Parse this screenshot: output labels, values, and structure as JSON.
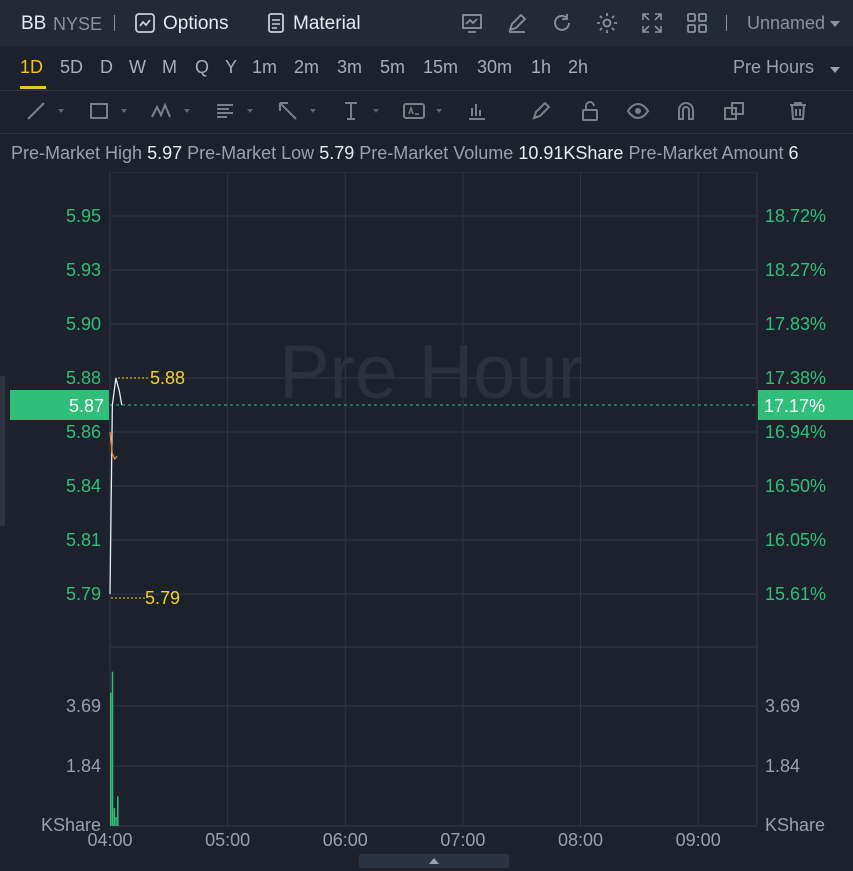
{
  "header": {
    "ticker": "BB",
    "exchange": "NYSE",
    "options_label": "Options",
    "material_label": "Material",
    "layout_name": "Unnamed",
    "icons": [
      "options-chart-icon",
      "document-icon",
      "chart-settings-icon",
      "edit-icon",
      "refresh-icon",
      "gear-icon",
      "fullscreen-icon",
      "grid-layout-icon",
      "chevron-down-icon"
    ]
  },
  "intervals": {
    "items": [
      "1D",
      "5D",
      "D",
      "W",
      "M",
      "Q",
      "Y",
      "1m",
      "2m",
      "3m",
      "5m",
      "15m",
      "30m",
      "1h",
      "2h"
    ],
    "active": "1D",
    "session_label": "Pre Hours"
  },
  "drawing_tools": [
    "line-tool-icon",
    "rectangle-tool-icon",
    "pattern-tool-icon",
    "text-list-tool-icon",
    "arrow-tool-icon",
    "text-tool-icon",
    "label-tool-icon",
    "indicator-tool-icon",
    "pencil-icon",
    "lock-icon",
    "eye-icon",
    "magnet-icon",
    "layers-icon",
    "trash-icon"
  ],
  "info": {
    "high_label": "Pre-Market High",
    "high_value": "5.97",
    "low_label": "Pre-Market Low",
    "low_value": "5.79",
    "volume_label": "Pre-Market Volume",
    "volume_value": "10.91KShare",
    "amount_label": "Pre-Market Amount",
    "amount_value": "6"
  },
  "chart_data": {
    "type": "line",
    "watermark": "Pre Hour",
    "price_ticks": [
      "5.95",
      "5.93",
      "5.90",
      "5.88",
      "5.86",
      "5.84",
      "5.81",
      "5.79"
    ],
    "percent_ticks": [
      "18.72%",
      "18.27%",
      "17.83%",
      "17.38%",
      "16.94%",
      "16.50%",
      "16.05%",
      "15.61%"
    ],
    "current_price": "5.87",
    "current_percent": "17.17%",
    "high_marker": "5.88",
    "low_marker": "5.79",
    "ylim": [
      5.79,
      5.95
    ],
    "x_ticks": [
      "04:00",
      "05:00",
      "06:00",
      "07:00",
      "08:00",
      "09:00"
    ],
    "price_series": {
      "x": [
        0.0,
        0.02,
        0.05,
        0.08,
        0.1
      ],
      "y": [
        5.79,
        5.87,
        5.88,
        5.875,
        5.87
      ]
    },
    "avg_series": {
      "x": [
        0.0,
        0.02,
        0.04,
        0.06
      ],
      "y": [
        5.86,
        5.852,
        5.85,
        5.851
      ]
    },
    "volume_ticks": [
      "3.69",
      "1.84"
    ],
    "volume_unit": "KShare",
    "volume_ylim": [
      0,
      6.0
    ],
    "volume_bars": [
      {
        "x": 0.0,
        "v": 4.5
      },
      {
        "x": 0.015,
        "v": 5.2
      },
      {
        "x": 0.03,
        "v": 0.6
      },
      {
        "x": 0.045,
        "v": 0.3
      },
      {
        "x": 0.06,
        "v": 1.0
      }
    ],
    "colors": {
      "up": "#2fbf78",
      "price_line": "#e8ebef",
      "avg_line": "#e8872a",
      "marker": "#f0d419"
    }
  }
}
